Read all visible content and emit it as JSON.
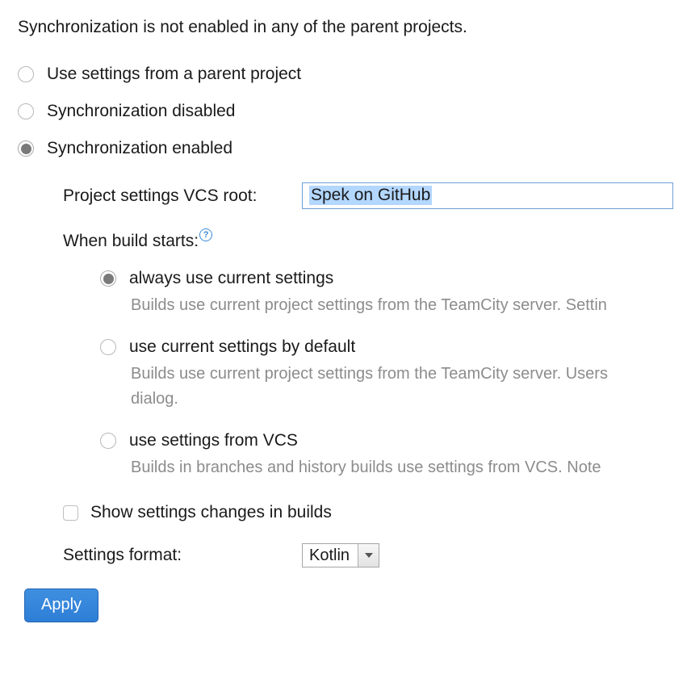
{
  "status_message": "Synchronization is not enabled in any of the parent projects.",
  "sync_options": {
    "use_parent": "Use settings from a parent project",
    "disabled": "Synchronization disabled",
    "enabled": "Synchronization enabled"
  },
  "vcs_root": {
    "label": "Project settings VCS root:",
    "value": "Spek on GitHub"
  },
  "when_build_starts": {
    "label": "When build starts:",
    "options": {
      "always_current": {
        "label": "always use current settings",
        "desc": "Builds use current project settings from the TeamCity server. Settin"
      },
      "current_default": {
        "label": "use current settings by default",
        "desc_line1": "Builds use current project settings from the TeamCity server. Users",
        "desc_line2": "dialog."
      },
      "from_vcs": {
        "label": "use settings from VCS",
        "desc": "Builds in branches and history builds use settings from VCS. Note "
      }
    }
  },
  "show_changes": "Show settings changes in builds",
  "settings_format": {
    "label": "Settings format:",
    "value": "Kotlin"
  },
  "apply_label": "Apply"
}
